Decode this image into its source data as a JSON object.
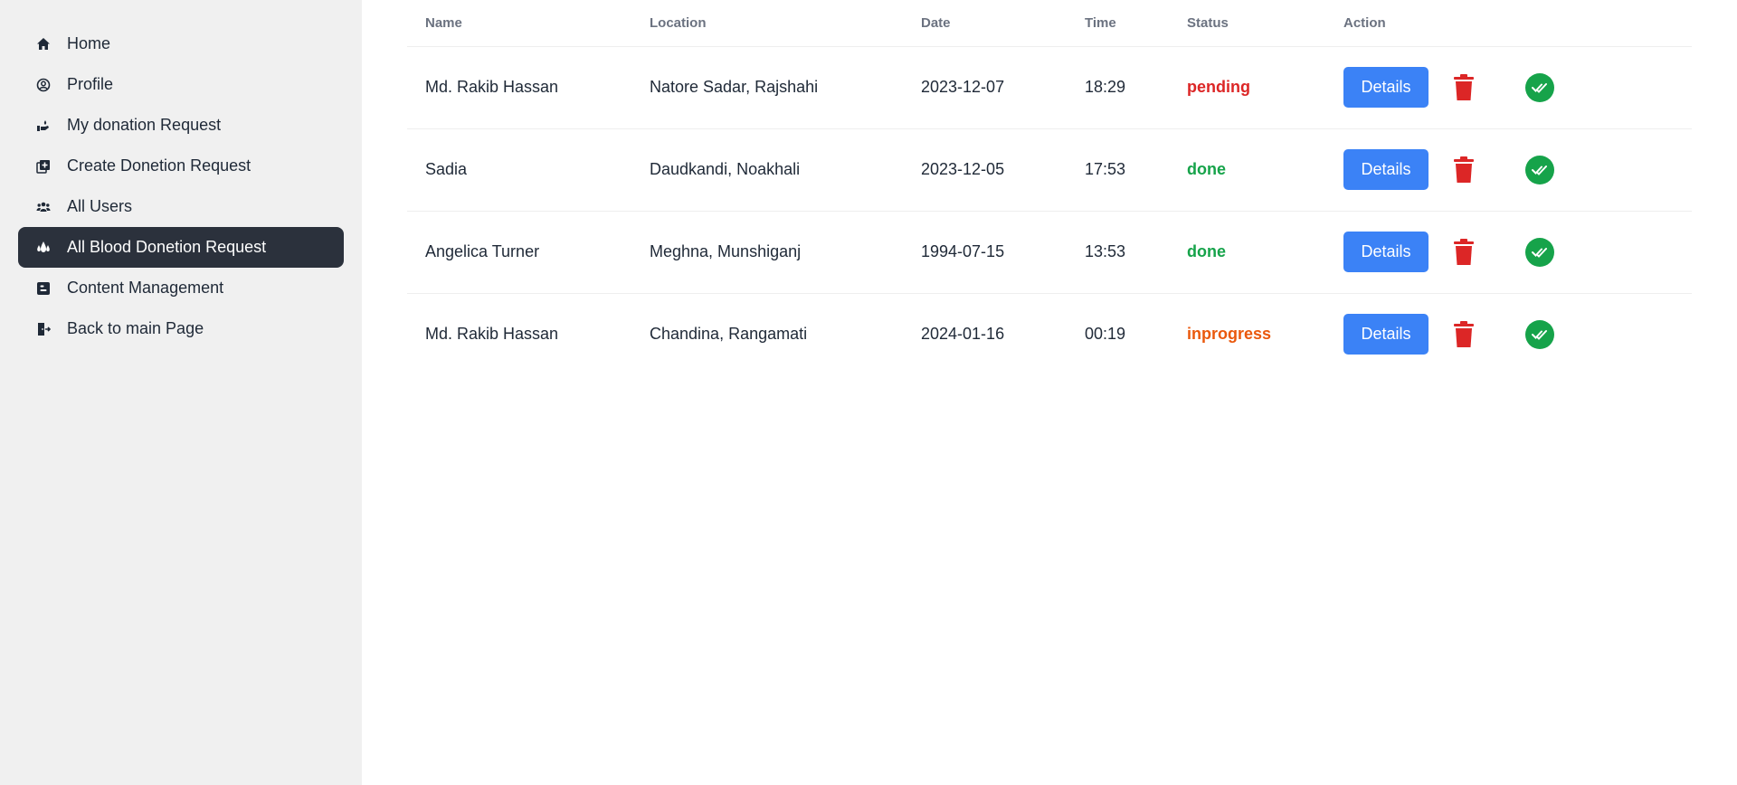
{
  "sidebar": {
    "items": [
      {
        "label": "Home",
        "icon": "home-icon",
        "active": false
      },
      {
        "label": "Profile",
        "icon": "user-circle-icon",
        "active": false
      },
      {
        "label": "My donation Request",
        "icon": "hand-donate-icon",
        "active": false
      },
      {
        "label": "Create Donetion Request",
        "icon": "add-box-icon",
        "active": false
      },
      {
        "label": "All Users",
        "icon": "users-icon",
        "active": false
      },
      {
        "label": "All Blood Donetion Request",
        "icon": "blood-drops-icon",
        "active": true
      },
      {
        "label": "Content Management",
        "icon": "blog-icon",
        "active": false
      },
      {
        "label": "Back to main Page",
        "icon": "exit-door-icon",
        "active": false
      }
    ]
  },
  "table": {
    "headers": [
      "Name",
      "Location",
      "Date",
      "Time",
      "Status",
      "Action"
    ],
    "rows": [
      {
        "name": "Md. Rakib Hassan",
        "location": "Natore Sadar, Rajshahi",
        "date": "2023-12-07",
        "time": "18:29",
        "status": "pending",
        "status_color": "#dc2626",
        "details": "Details"
      },
      {
        "name": "Sadia",
        "location": "Daudkandi, Noakhali",
        "date": "2023-12-05",
        "time": "17:53",
        "status": "done",
        "status_color": "#16a34a",
        "details": "Details"
      },
      {
        "name": "Angelica Turner",
        "location": "Meghna, Munshiganj",
        "date": "1994-07-15",
        "time": "13:53",
        "status": "done",
        "status_color": "#16a34a",
        "details": "Details"
      },
      {
        "name": "Md. Rakib Hassan",
        "location": "Chandina, Rangamati",
        "date": "2024-01-16",
        "time": "00:19",
        "status": "inprogress",
        "status_color": "#ea580c",
        "details": "Details"
      }
    ]
  },
  "colors": {
    "sidebar_bg": "#f0f0f0",
    "active_bg": "#2b313c",
    "details_button": "#3b82f6",
    "delete_icon": "#dc2626",
    "approve_icon": "#16a34a"
  }
}
